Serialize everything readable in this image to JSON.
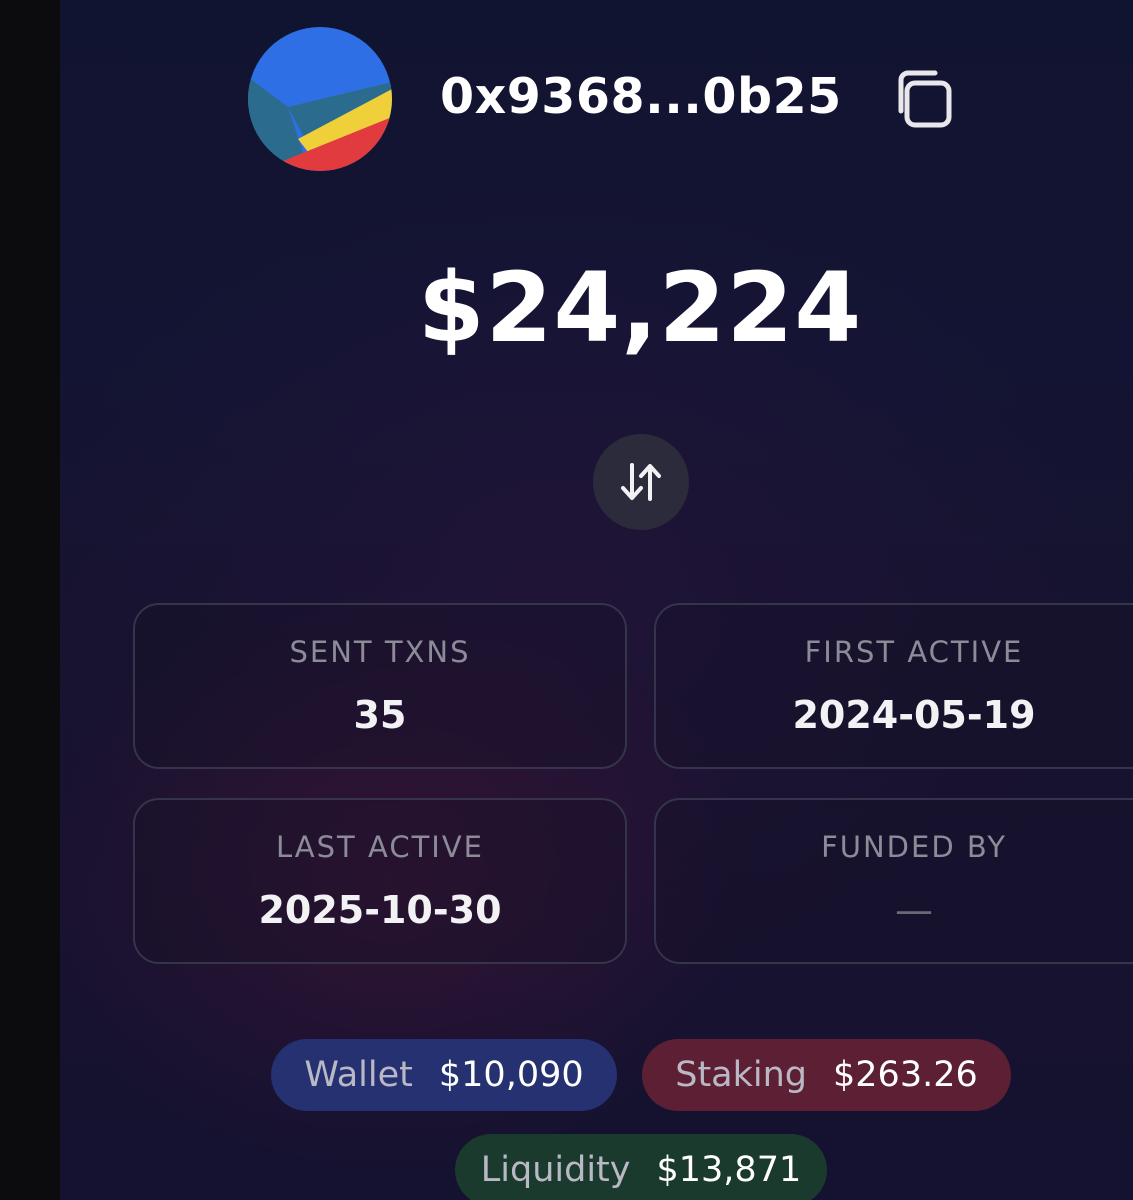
{
  "profile": {
    "address": "0x9368...0b25",
    "avatar_colors": [
      "#2f6fe6",
      "#2b6c8e",
      "#efcf3a",
      "#e23b3f"
    ]
  },
  "icons": {
    "copy": "copy-icon",
    "swap": "swap-arrows-icon"
  },
  "balance": {
    "total": "$24,224"
  },
  "stats": {
    "sent_txns": {
      "label": "SENT TXNS",
      "value": "35"
    },
    "first_active": {
      "label": "FIRST ACTIVE",
      "value": "2024-05-19"
    },
    "last_active": {
      "label": "LAST ACTIVE",
      "value": "2025-10-30"
    },
    "funded_by": {
      "label": "FUNDED BY",
      "value": "—"
    }
  },
  "breakdown": {
    "wallet": {
      "label": "Wallet",
      "value": "$10,090",
      "color": "#253170"
    },
    "staking": {
      "label": "Staking",
      "value": "$263.26",
      "color": "#5c1f33"
    },
    "liquidity": {
      "label": "Liquidity",
      "value": "$13,871",
      "color": "#1b3a2e"
    }
  }
}
